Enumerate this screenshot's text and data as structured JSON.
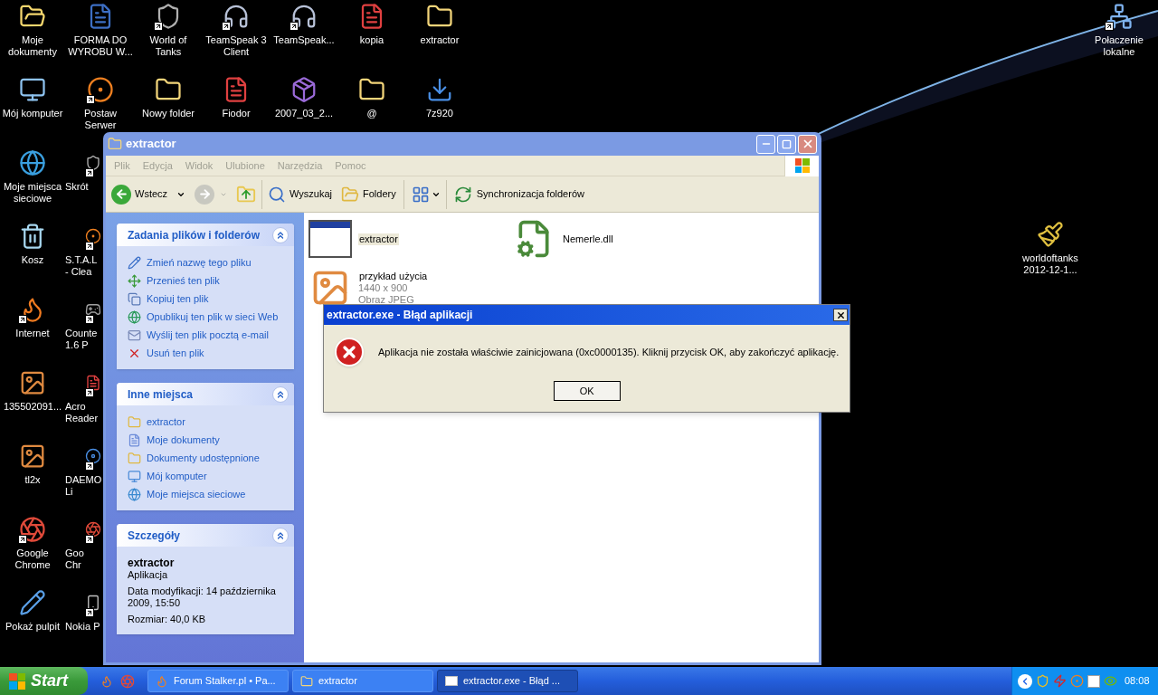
{
  "desktop": {
    "icons": [
      {
        "label": "Moje dokumenty",
        "kind": "docs",
        "shortcut": false
      },
      {
        "label": "FORMA DO WYROBU W...",
        "kind": "word",
        "shortcut": false
      },
      {
        "label": "World of Tanks",
        "kind": "game",
        "shortcut": true
      },
      {
        "label": "TeamSpeak 3 Client",
        "kind": "voice",
        "shortcut": true
      },
      {
        "label": "TeamSpeak...",
        "kind": "voice",
        "shortcut": true
      },
      {
        "label": "kopia",
        "kind": "pdf",
        "shortcut": false
      },
      {
        "label": "extractor",
        "kind": "folder",
        "shortcut": false
      },
      {
        "label": "Połaczenie lokalne",
        "kind": "network",
        "shortcut": true
      },
      {
        "label": "Mój komputer",
        "kind": "computer",
        "shortcut": false
      },
      {
        "label": "Postaw Serwer",
        "kind": "lambda",
        "shortcut": true
      },
      {
        "label": "Nowy folder",
        "kind": "folder",
        "shortcut": false
      },
      {
        "label": "Fiodor",
        "kind": "pdf",
        "shortcut": false
      },
      {
        "label": "2007_03_2...",
        "kind": "archive",
        "shortcut": false
      },
      {
        "label": "@",
        "kind": "folder",
        "shortcut": false
      },
      {
        "label": "7z920",
        "kind": "installer",
        "shortcut": false
      },
      {
        "label": "Moje miejsca sieciowe",
        "kind": "globe",
        "shortcut": false
      },
      {
        "label": "Kosz",
        "kind": "trash",
        "shortcut": false
      },
      {
        "label": "Internet",
        "kind": "firefox",
        "shortcut": true
      },
      {
        "label": "135502091...",
        "kind": "image",
        "shortcut": false
      },
      {
        "label": "tl2x",
        "kind": "image",
        "shortcut": false
      },
      {
        "label": "Google Chrome",
        "kind": "chrome",
        "shortcut": true
      },
      {
        "label": "Pokaż pulpit",
        "kind": "pen",
        "shortcut": false
      },
      {
        "label": "worldoftanks 2012-12-1...",
        "kind": "paint",
        "shortcut": false
      }
    ],
    "covered_icons": [
      {
        "lines": [
          "Skrót"
        ],
        "kind": "game",
        "shortcut": true
      },
      {
        "lines": [
          "S.T.A.L",
          "- Clea"
        ],
        "kind": "lambda",
        "shortcut": true
      },
      {
        "lines": [
          "Counte",
          "1.6 P"
        ],
        "kind": "gamepad",
        "shortcut": true
      },
      {
        "lines": [
          "Acro",
          "Reader"
        ],
        "kind": "pdf",
        "shortcut": true
      },
      {
        "lines": [
          "DAEMO",
          "Li"
        ],
        "kind": "disc",
        "shortcut": true
      },
      {
        "lines": [
          "Goo",
          "Chr"
        ],
        "kind": "chrome",
        "shortcut": true
      },
      {
        "lines": [
          "Nokia P"
        ],
        "kind": "phone",
        "shortcut": true
      }
    ]
  },
  "explorer": {
    "title": "extractor",
    "menu": [
      "Plik",
      "Edycja",
      "Widok",
      "Ulubione",
      "Narzędzia",
      "Pomoc"
    ],
    "toolbar": [
      {
        "kind": "back",
        "label": "Wstecz"
      },
      {
        "kind": "forward"
      },
      {
        "kind": "up"
      },
      {
        "kind": "search",
        "label": "Wyszukaj"
      },
      {
        "kind": "folders",
        "label": "Foldery"
      },
      {
        "kind": "views"
      },
      {
        "kind": "sync",
        "label": "Synchronizacja folderów"
      }
    ],
    "panels": [
      {
        "kind": "links",
        "title": "Zadania plików i folderów",
        "expanded": true,
        "items": [
          {
            "label": "Zmień nazwę tego pliku",
            "kind": "rename"
          },
          {
            "label": "Przenieś ten plik",
            "kind": "move"
          },
          {
            "label": "Kopiuj ten plik",
            "kind": "copy"
          },
          {
            "label": "Opublikuj ten plik w sieci Web",
            "kind": "web"
          },
          {
            "label": "Wyślij ten plik pocztą e-mail",
            "kind": "mail"
          },
          {
            "label": "Usuń ten plik",
            "kind": "delete"
          }
        ]
      },
      {
        "kind": "links",
        "title": "Inne miejsca",
        "expanded": true,
        "items": [
          {
            "label": "extractor",
            "kind": "folder"
          },
          {
            "label": "Moje dokumenty",
            "kind": "docs"
          },
          {
            "label": "Dokumenty udostępnione",
            "kind": "folder"
          },
          {
            "label": "Mój komputer",
            "kind": "computer"
          },
          {
            "label": "Moje miejsca sieciowe",
            "kind": "network"
          }
        ]
      },
      {
        "kind": "details",
        "title": "Szczegóły",
        "expanded": true,
        "name": "extractor",
        "type": "Aplikacja",
        "modified": "Data modyfikacji: 14 października 2009, 15:50",
        "size": "Rozmiar: 40,0 KB"
      }
    ],
    "files": [
      {
        "name": "extractor",
        "kind": "app",
        "selected": true
      },
      {
        "name": "Nemerle.dll",
        "kind": "dll",
        "selected": false
      },
      {
        "name": "przykład użycia",
        "kind": "image",
        "selected": false,
        "dimensions": "1440 x 900",
        "type": "Obraz JPEG"
      }
    ]
  },
  "dialog": {
    "title": "extractor.exe - Błąd aplikacji",
    "message": "Aplikacja nie została właściwie zainicjowana (0xc0000135). Kliknij przycisk OK, aby zakończyć aplikację.",
    "button": "OK"
  },
  "taskbar": {
    "start": "Start",
    "quick_launch": [
      {
        "kind": "browser"
      },
      {
        "kind": "chrome"
      }
    ],
    "tasks": [
      {
        "label": "Forum Stalker.pl • Pa...",
        "kind": "browser",
        "selected": false
      },
      {
        "label": "extractor",
        "kind": "folder",
        "selected": false
      },
      {
        "label": "extractor.exe - Błąd ...",
        "kind": "window",
        "selected": true
      }
    ],
    "clock": "08:08"
  }
}
